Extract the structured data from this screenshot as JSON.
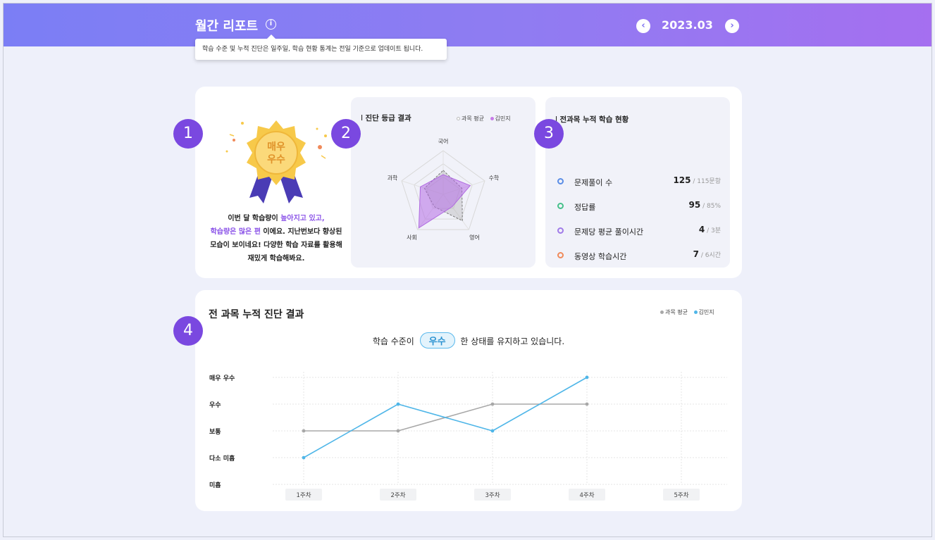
{
  "header": {
    "title": "월간 리포트",
    "info_tooltip": "학습 수준 및 누적 진단은 일주일, 학습 현황 통계는 전일 기준으로 업데이트 됩니다.",
    "month": "2023.03",
    "prev_icon": "chevron-left-icon",
    "next_icon": "chevron-right-icon"
  },
  "badges": [
    "1",
    "2",
    "3",
    "4"
  ],
  "medal": {
    "line1": "매우",
    "line2": "우수"
  },
  "summary": {
    "part1": "이번 달 학습량이 ",
    "hl1": "높아지고 있고,",
    "hl2": "학습량은 많은 편",
    "part2": " 이에요. 지난번보다 향상된 모습이 보이네요! 다양한 학습 자료를 활용해 재밌게 학습해봐요."
  },
  "radar": {
    "title": "진단 등급 결과",
    "legend": [
      {
        "label": "과목 평균",
        "color": "#c9c9c9"
      },
      {
        "label": "김민지",
        "color": "#c77be8"
      }
    ],
    "axes": [
      "국어",
      "수학",
      "영어",
      "사회",
      "과학"
    ],
    "avg": [
      0.55,
      0.45,
      0.75,
      0.35,
      0.45
    ],
    "student": [
      0.45,
      0.65,
      0.35,
      0.95,
      0.55
    ]
  },
  "stats": {
    "title": "전과목 누적 학습 현황",
    "items": [
      {
        "label": "문제풀이 수",
        "value": "125",
        "sub": " / 115문항",
        "color": "#5a8de6"
      },
      {
        "label": "정답률",
        "value": "95",
        "sub": " / 85%",
        "color": "#45c08a"
      },
      {
        "label": "문제당 평균 풀이시간",
        "value": "4",
        "sub": " / 3분",
        "color": "#a07ae8"
      },
      {
        "label": "동영상 학습시간",
        "value": "7",
        "sub": " / 6시간",
        "color": "#f08a5a"
      }
    ]
  },
  "cumulative": {
    "title": "전 과목 누적 진단 결과",
    "legend": [
      {
        "label": "과목 평균",
        "color": "#a8a8a8"
      },
      {
        "label": "김민지",
        "color": "#4fb6e8"
      }
    ],
    "msg_before": "학습 수준이",
    "msg_level": "우수",
    "msg_after": "한 상태를 유지하고 있습니다."
  },
  "chart_data": {
    "type": "line",
    "categories": [
      "1주차",
      "2주차",
      "3주차",
      "4주차",
      "5주차"
    ],
    "y_levels": [
      "미흡",
      "다소 미흡",
      "보통",
      "우수",
      "매우 우수"
    ],
    "series": [
      {
        "name": "과목 평균",
        "color": "#a8a8a8",
        "values": [
          2,
          2,
          3,
          3,
          null
        ]
      },
      {
        "name": "김민지",
        "color": "#4fb6e8",
        "values": [
          1,
          3,
          2,
          4,
          null
        ]
      }
    ],
    "xlabel": "",
    "ylabel": "",
    "grid": true,
    "legend": "top-right"
  }
}
